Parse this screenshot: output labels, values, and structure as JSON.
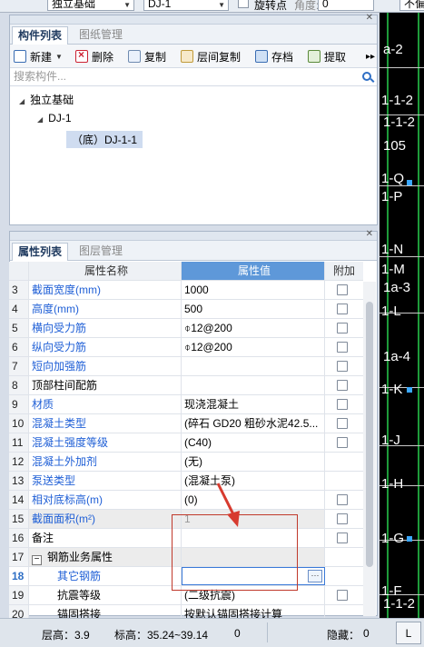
{
  "topbar": {
    "type_combo": "独立基础",
    "name_combo": "DJ-1",
    "rotate_label": "旋转点",
    "angle_label": "角度:",
    "angle_value": "0",
    "right_text": "不偏"
  },
  "component_panel": {
    "tabs": [
      "构件列表",
      "图纸管理"
    ],
    "toolbar": {
      "new": "新建",
      "delete": "删除",
      "copy": "复制",
      "floor_copy": "层间复制",
      "save": "存档",
      "extract": "提取",
      "more": "▸▸"
    },
    "search_placeholder": "搜索构件...",
    "tree": {
      "root": "独立基础",
      "child": "DJ-1",
      "leaf": "（底）DJ-1-1"
    }
  },
  "property_panel": {
    "tabs": [
      "属性列表",
      "图层管理"
    ],
    "headers": {
      "name": "属性名称",
      "value": "属性值",
      "add": "附加"
    },
    "rows": [
      {
        "num": "3",
        "name": "截面宽度(mm)",
        "value": "1000",
        "blue": true,
        "check": true
      },
      {
        "num": "4",
        "name": "高度(mm)",
        "value": "500",
        "blue": true,
        "check": true
      },
      {
        "num": "5",
        "name": "横向受力筋",
        "value": "⌽12@200",
        "blue": true,
        "check": true
      },
      {
        "num": "6",
        "name": "纵向受力筋",
        "value": "⌽12@200",
        "blue": true,
        "check": true
      },
      {
        "num": "7",
        "name": "短向加强筋",
        "value": "",
        "blue": true,
        "check": true
      },
      {
        "num": "8",
        "name": "顶部柱间配筋",
        "value": "",
        "blue": false,
        "check": true
      },
      {
        "num": "9",
        "name": "材质",
        "value": "现浇混凝土",
        "blue": true,
        "check": true
      },
      {
        "num": "10",
        "name": "混凝土类型",
        "value": "(碎石 GD20 粗砂水泥42.5...",
        "blue": true,
        "check": true
      },
      {
        "num": "11",
        "name": "混凝土强度等级",
        "value": "(C40)",
        "blue": true,
        "check": true
      },
      {
        "num": "12",
        "name": "混凝土外加剂",
        "value": "(无)",
        "blue": true,
        "check": false
      },
      {
        "num": "13",
        "name": "泵送类型",
        "value": "(混凝土泵)",
        "blue": true,
        "check": false
      },
      {
        "num": "14",
        "name": "相对底标高(m)",
        "value": "(0)",
        "blue": true,
        "check": true
      },
      {
        "num": "15",
        "name": "截面面积(m²)",
        "value": "1",
        "blue": true,
        "check": true
      },
      {
        "num": "16",
        "name": "备注",
        "value": "",
        "blue": false,
        "check": true
      },
      {
        "num": "17",
        "name": "钢筋业务属性",
        "value": "",
        "blue": false,
        "check": false
      },
      {
        "num": "18",
        "name": "其它钢筋",
        "value": "",
        "blue": true,
        "check": false
      },
      {
        "num": "19",
        "name": "抗震等级",
        "value": "(二级抗震)",
        "blue": false,
        "check": true
      },
      {
        "num": "20",
        "name": "锚固搭接",
        "value": "按默认锚固搭接计算",
        "blue": false,
        "check": false
      }
    ]
  },
  "cad": {
    "labels": [
      "a-2",
      "1-1-2",
      "1-1-2",
      "105",
      "1-Q",
      "1-P",
      "1-N",
      "1-M",
      "1a-3",
      "1-L",
      "1a-4",
      "1-K",
      "1-J",
      "1-H",
      "1-G",
      "1-F",
      "1-1-2"
    ]
  },
  "status": {
    "floor_height": "层高：3.9",
    "elevation": "标高：35.24~39.14",
    "zero": "0",
    "hidden": "隐藏：",
    "hidden_count": "0",
    "corner": "L"
  },
  "colors": {
    "header_value_bg": "#5e98d9",
    "blue_text": "#1f5fd6",
    "annotation_red": "#c0392b",
    "cad_green": "#1e9b3a"
  }
}
